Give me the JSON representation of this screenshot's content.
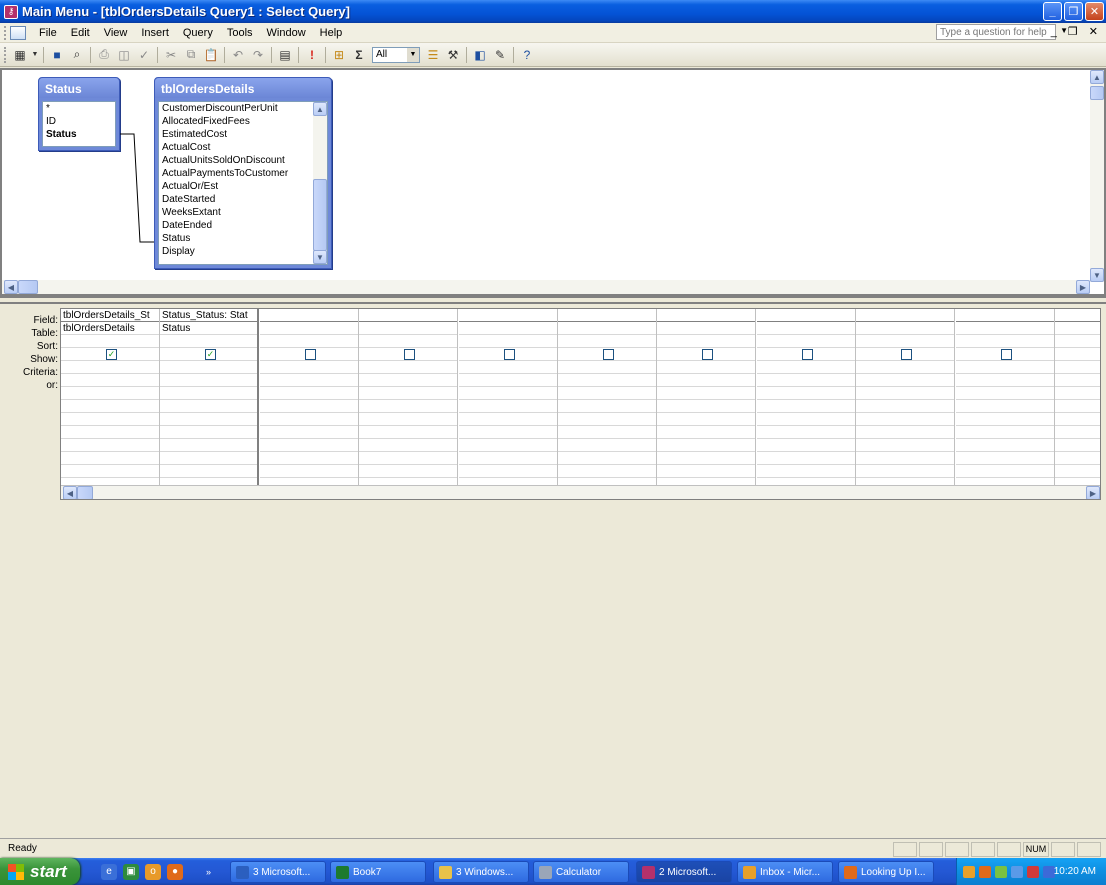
{
  "window": {
    "title": "Main Menu - [tblOrdersDetails Query1 : Select Query]"
  },
  "menu": {
    "items": [
      "File",
      "Edit",
      "View",
      "Insert",
      "Query",
      "Tools",
      "Window",
      "Help"
    ],
    "help_placeholder": "Type a question for help"
  },
  "toolbar": {
    "top_values": "All"
  },
  "field_lists": [
    {
      "title": "Status",
      "fields": [
        "*",
        "ID",
        "Status"
      ],
      "bold_field": "Status"
    },
    {
      "title": "tblOrdersDetails",
      "fields": [
        "CustomerDiscountPerUnit",
        "AllocatedFixedFees",
        "EstimatedCost",
        "ActualCost",
        "ActualUnitsSoldOnDiscount",
        "ActualPaymentsToCustomer",
        "ActualOr/Est",
        "DateStarted",
        "WeeksExtant",
        "DateEnded",
        "Status",
        "Display"
      ]
    }
  ],
  "grid": {
    "row_labels": [
      "Field:",
      "Table:",
      "Sort:",
      "Show:",
      "Criteria:",
      "or:"
    ],
    "columns": [
      {
        "field": "tblOrdersDetails_St",
        "table": "tblOrdersDetails",
        "show": true
      },
      {
        "field": "Status_Status: Stat",
        "table": "Status",
        "show": true
      },
      {
        "field": "",
        "table": "",
        "show": false
      },
      {
        "field": "",
        "table": "",
        "show": false
      },
      {
        "field": "",
        "table": "",
        "show": false
      },
      {
        "field": "",
        "table": "",
        "show": false
      },
      {
        "field": "",
        "table": "",
        "show": false
      },
      {
        "field": "",
        "table": "",
        "show": false
      },
      {
        "field": "",
        "table": "",
        "show": false
      },
      {
        "field": "",
        "table": "",
        "show": false
      },
      {
        "field": "",
        "table": "",
        "show": false
      }
    ]
  },
  "status": {
    "text": "Ready",
    "num": "NUM"
  },
  "taskbar": {
    "start_label": "start",
    "tasks": [
      {
        "label": "3 Microsoft...",
        "color": "#2b5fbf"
      },
      {
        "label": "Book7",
        "color": "#1d7a2f"
      },
      {
        "label": "3 Windows...",
        "color": "#e8c24a"
      },
      {
        "label": "Calculator",
        "color": "#9aa6b8"
      },
      {
        "label": "2 Microsoft...",
        "color": "#b3316b"
      },
      {
        "label": "Inbox - Micr...",
        "color": "#e8a02a"
      },
      {
        "label": "Looking Up I...",
        "color": "#e06a1a"
      }
    ],
    "clock": "10:20 AM"
  }
}
